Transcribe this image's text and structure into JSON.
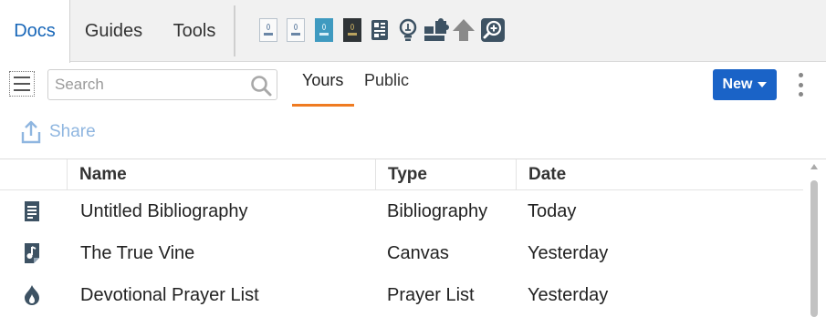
{
  "top_tabs": [
    {
      "label": "Docs",
      "active": true
    },
    {
      "label": "Guides",
      "active": false
    },
    {
      "label": "Tools",
      "active": false
    }
  ],
  "quick_access": [
    {
      "icon": "book-cover-icon"
    },
    {
      "icon": "book-cover-icon"
    },
    {
      "icon": "book-cover-teal-icon"
    },
    {
      "icon": "book-cover-dark-icon"
    },
    {
      "icon": "layout-icon"
    },
    {
      "icon": "lightbulb-icon"
    },
    {
      "icon": "puzzle-icon"
    },
    {
      "icon": "arrow-up-icon"
    },
    {
      "icon": "zoom-in-icon"
    }
  ],
  "toolbar": {
    "search_placeholder": "Search",
    "search_value": "",
    "subtabs": [
      {
        "label": "Yours",
        "active": true
      },
      {
        "label": "Public",
        "active": false
      }
    ],
    "new_label": "New",
    "share_label": "Share"
  },
  "table": {
    "columns": [
      "Name",
      "Type",
      "Date"
    ],
    "rows": [
      {
        "icon": "document-icon",
        "name": "Untitled Bibliography",
        "type": "Bibliography",
        "date": "Today"
      },
      {
        "icon": "canvas-icon",
        "name": "The True Vine",
        "type": "Canvas",
        "date": "Yesterday"
      },
      {
        "icon": "prayer-flame-icon",
        "name": "Devotional Prayer List",
        "type": "Prayer List",
        "date": "Yesterday"
      }
    ]
  },
  "colors": {
    "accent_blue": "#1a63c7",
    "active_tab_text": "#1766b8",
    "subtab_underline": "#ef7b21",
    "share_disabled": "#8fb6e0",
    "row_icon": "#3d5263"
  }
}
